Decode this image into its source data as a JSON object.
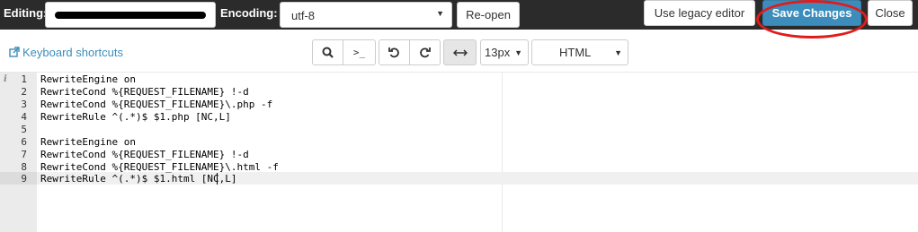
{
  "header": {
    "editing_label": "Editing:",
    "encoding_label": "Encoding:",
    "encoding_value": "utf-8",
    "reopen_label": "Re-open",
    "legacy_label": "Use legacy editor",
    "save_label": "Save Changes",
    "close_label": "Close"
  },
  "toolbar": {
    "keyboard_shortcuts": "Keyboard shortcuts",
    "font_size": "13px",
    "mode": "HTML",
    "shell_symbol": ">_"
  },
  "editor": {
    "info_marker": "i",
    "active_line": 9,
    "lines": [
      {
        "num": "1",
        "text": "RewriteEngine on"
      },
      {
        "num": "2",
        "text": "RewriteCond %{REQUEST_FILENAME} !-d"
      },
      {
        "num": "3",
        "text": "RewriteCond %{REQUEST_FILENAME}\\.php -f"
      },
      {
        "num": "4",
        "text": "RewriteRule ^(.*)$ $1.php [NC,L]"
      },
      {
        "num": "5",
        "text": ""
      },
      {
        "num": "6",
        "text": "RewriteEngine on"
      },
      {
        "num": "7",
        "text": "RewriteCond %{REQUEST_FILENAME} !-d"
      },
      {
        "num": "8",
        "text": "RewriteCond %{REQUEST_FILENAME}\\.html -f"
      },
      {
        "num": "9",
        "text": "RewriteRule ^(.*)$ $1.html [NC,L]"
      }
    ]
  },
  "colors": {
    "topbar": "#2b2b2b",
    "primary": "#3c8dbc",
    "highlight": "#e21b1b"
  }
}
